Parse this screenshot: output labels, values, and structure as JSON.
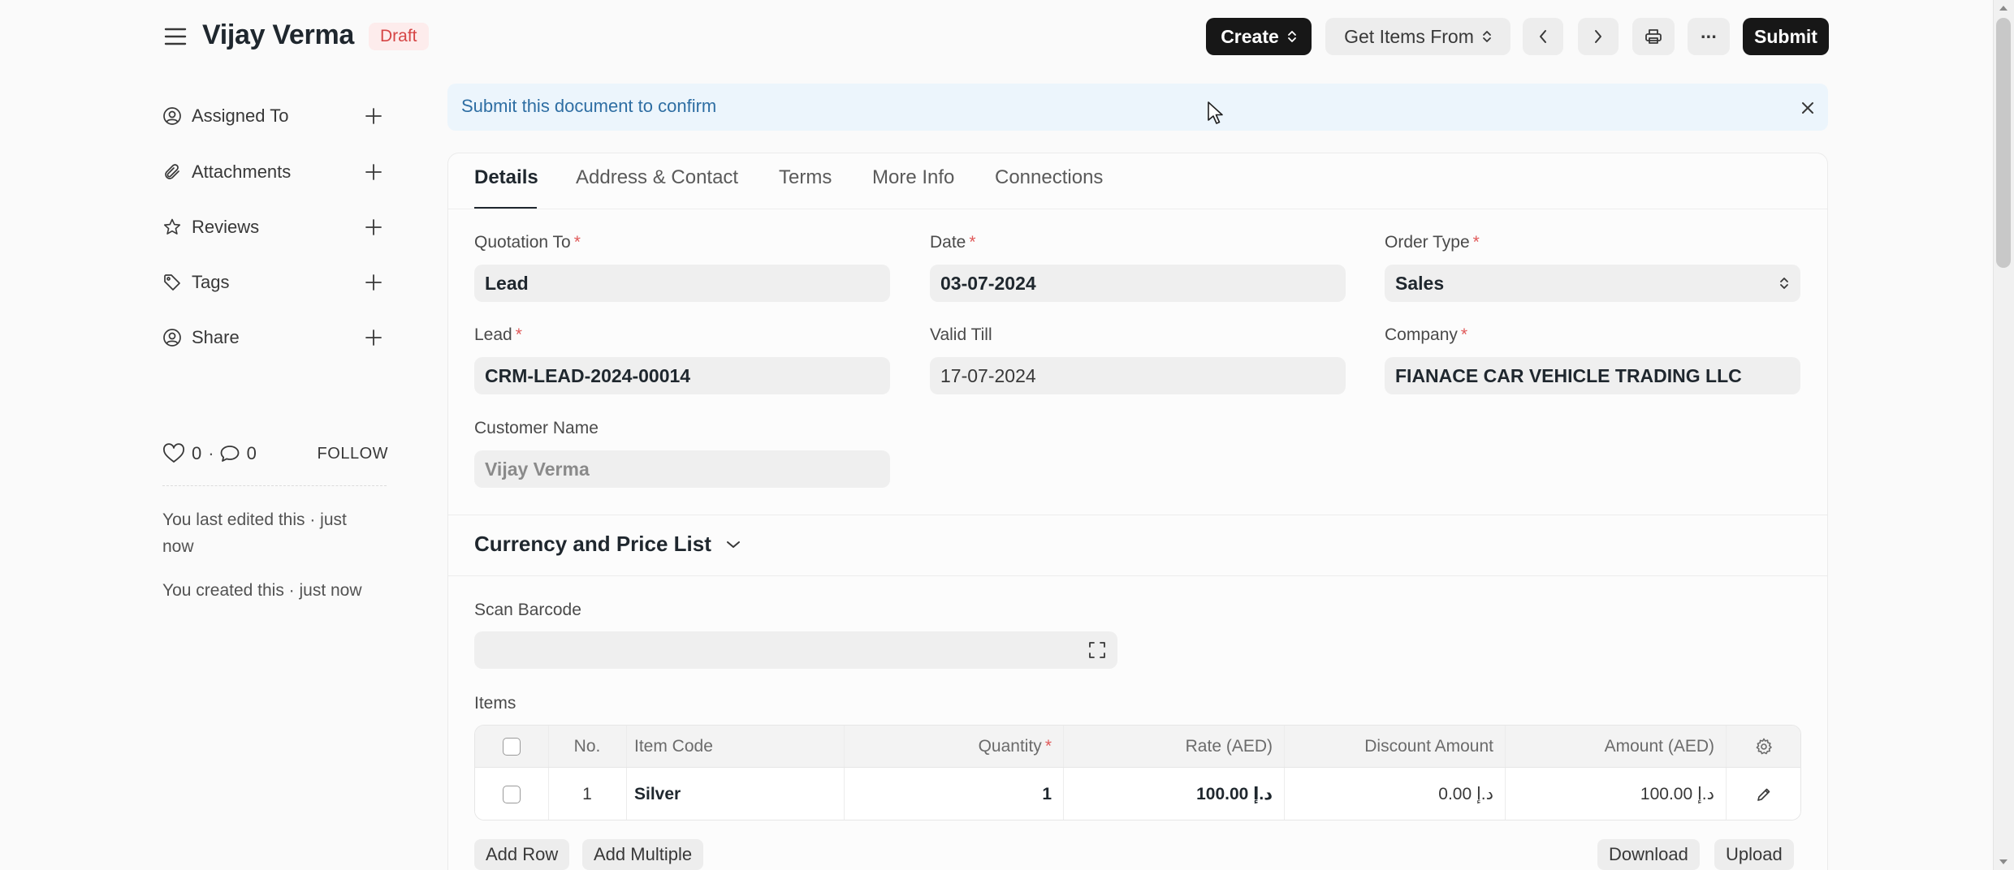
{
  "header": {
    "title": "Vijay Verma",
    "status": "Draft",
    "create_label": "Create",
    "get_items_label": "Get Items From",
    "more_label": "···",
    "submit_label": "Submit"
  },
  "sidebar": {
    "items": [
      {
        "label": "Assigned To",
        "icon": "assign-user-icon"
      },
      {
        "label": "Attachments",
        "icon": "paperclip-icon"
      },
      {
        "label": "Reviews",
        "icon": "star-icon"
      },
      {
        "label": "Tags",
        "icon": "tag-icon"
      },
      {
        "label": "Share",
        "icon": "share-user-icon"
      }
    ],
    "likes": "0",
    "comments": "0",
    "follow_label": "FOLLOW",
    "activity": [
      "You last edited this · just now",
      "You created this · just now"
    ]
  },
  "alert": {
    "text": "Submit this document to confirm"
  },
  "tabs": [
    {
      "label": "Details",
      "active": true
    },
    {
      "label": "Address & Contact",
      "active": false
    },
    {
      "label": "Terms",
      "active": false
    },
    {
      "label": "More Info",
      "active": false
    },
    {
      "label": "Connections",
      "active": false
    }
  ],
  "form": {
    "quotation_to": {
      "label": "Quotation To",
      "value": "Lead"
    },
    "date": {
      "label": "Date",
      "value": "03-07-2024"
    },
    "order_type": {
      "label": "Order Type",
      "value": "Sales"
    },
    "lead": {
      "label": "Lead",
      "value": "CRM-LEAD-2024-00014"
    },
    "valid_till": {
      "label": "Valid Till",
      "value": "17-07-2024"
    },
    "company": {
      "label": "Company",
      "value": "FIANACE CAR VEHICLE TRADING LLC"
    },
    "customer_name": {
      "label": "Customer Name",
      "value": "Vijay Verma"
    },
    "required_mark": "*"
  },
  "currency_section": {
    "title": "Currency and Price List"
  },
  "barcode": {
    "label": "Scan Barcode",
    "value": ""
  },
  "items": {
    "label": "Items",
    "columns": {
      "no": "No.",
      "item_code": "Item Code",
      "quantity": "Quantity",
      "rate": "Rate (AED)",
      "discount": "Discount Amount",
      "amount": "Amount (AED)"
    },
    "rows": [
      {
        "no": "1",
        "item_code": "Silver",
        "quantity": "1",
        "rate": "د.إ 100.00",
        "discount": "د.إ 0.00",
        "amount": "د.إ 100.00"
      }
    ],
    "add_row_label": "Add Row",
    "add_multiple_label": "Add Multiple",
    "download_label": "Download",
    "upload_label": "Upload"
  },
  "colors": {
    "primary_button": "#171717",
    "draft_badge_bg": "#fdecec",
    "draft_badge_text": "#d64545",
    "alert_bg": "#ecf5fc",
    "alert_text": "#2e6ea3",
    "required": "#e05a5a"
  }
}
